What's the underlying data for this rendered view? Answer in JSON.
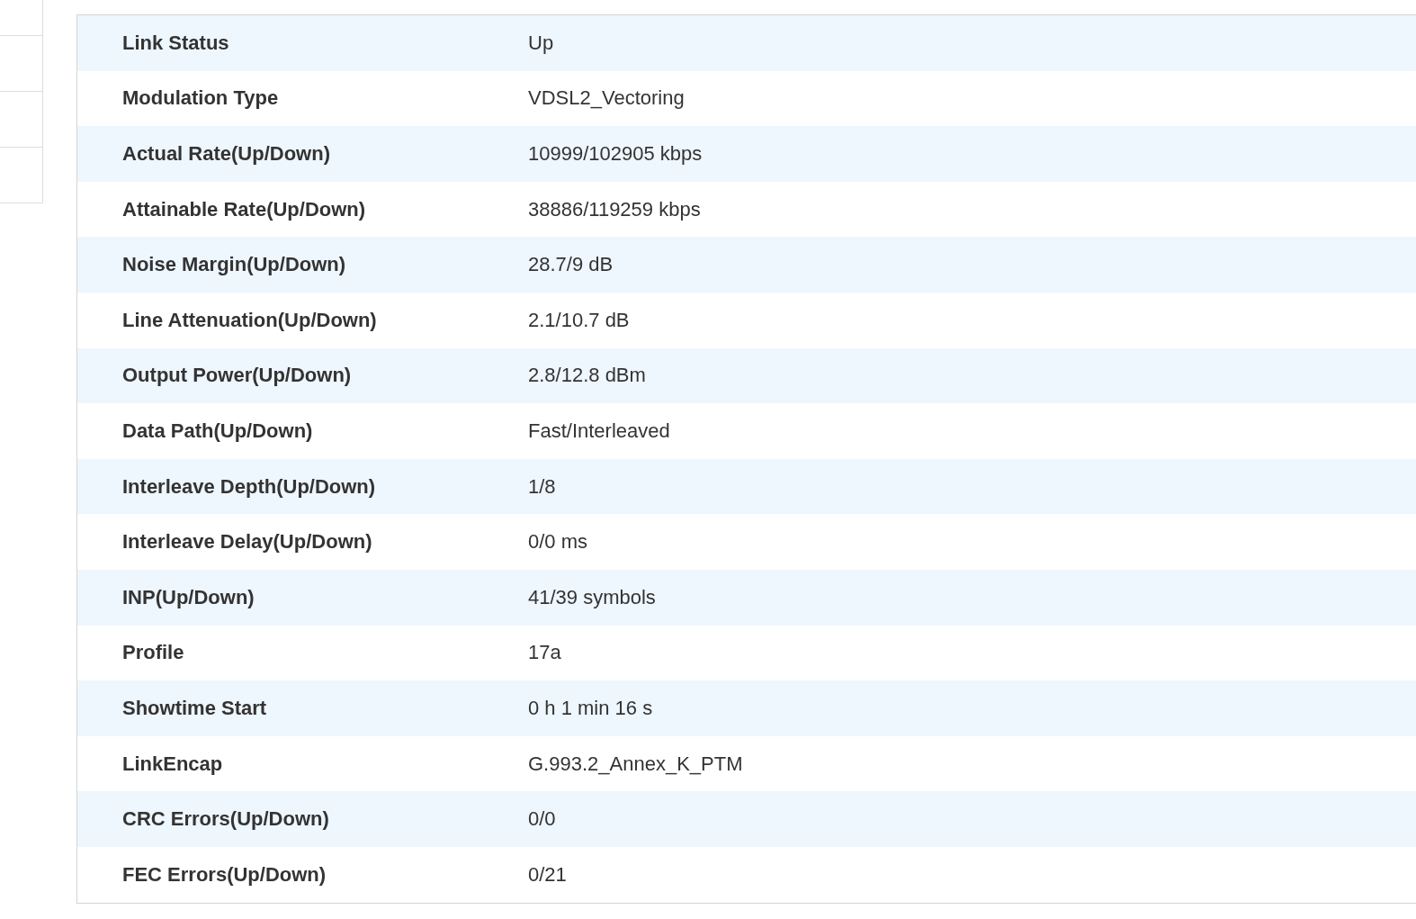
{
  "rows": [
    {
      "label": "Link Status",
      "value": "Up"
    },
    {
      "label": "Modulation Type",
      "value": "VDSL2_Vectoring"
    },
    {
      "label": "Actual Rate(Up/Down)",
      "value": "10999/102905 kbps"
    },
    {
      "label": "Attainable Rate(Up/Down)",
      "value": "38886/119259 kbps"
    },
    {
      "label": "Noise Margin(Up/Down)",
      "value": "28.7/9 dB"
    },
    {
      "label": "Line Attenuation(Up/Down)",
      "value": "2.1/10.7 dB"
    },
    {
      "label": "Output Power(Up/Down)",
      "value": "2.8/12.8 dBm"
    },
    {
      "label": "Data Path(Up/Down)",
      "value": "Fast/Interleaved"
    },
    {
      "label": "Interleave Depth(Up/Down)",
      "value": "1/8"
    },
    {
      "label": "Interleave Delay(Up/Down)",
      "value": "0/0 ms"
    },
    {
      "label": "INP(Up/Down)",
      "value": "41/39 symbols"
    },
    {
      "label": "Profile",
      "value": "17a"
    },
    {
      "label": "Showtime Start",
      "value": "0 h 1 min 16 s"
    },
    {
      "label": "LinkEncap",
      "value": "G.993.2_Annex_K_PTM"
    },
    {
      "label": "CRC Errors(Up/Down)",
      "value": "0/0"
    },
    {
      "label": "FEC Errors(Up/Down)",
      "value": "0/21"
    }
  ]
}
